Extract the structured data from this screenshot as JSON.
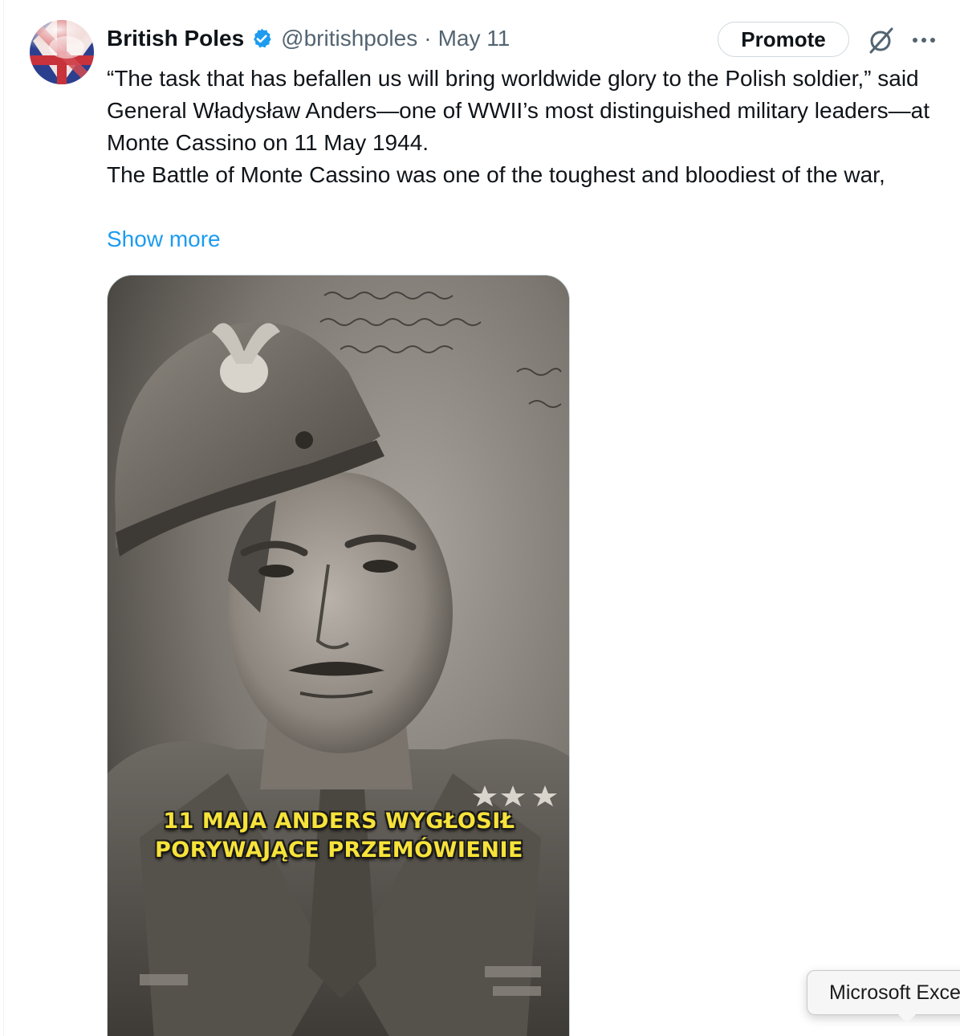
{
  "author": {
    "display_name": "British Poles",
    "verified_icon": "verified-badge-icon",
    "handle": "@britishpoles",
    "separator": "·",
    "date": "May 11"
  },
  "actions": {
    "promote_label": "Promote",
    "grok_icon": "grok-icon",
    "more_icon": "more-icon"
  },
  "tweet": {
    "paragraph_1": "“The task that has befallen us will bring worldwide glory to the Polish soldier,” said General Władysław Anders—one of WWII’s most distinguished military leaders—at Monte Cassino on 11 May 1944.",
    "paragraph_2": "The Battle of Monte Cassino was one of the toughest and bloodiest of the war,",
    "show_more": "Show more"
  },
  "media": {
    "caption_line_1": "11 MAJA ANDERS WYGŁOSIŁ",
    "caption_line_2": "PORYWAJĄCE PRZEMÓWIENIE"
  },
  "tooltip": {
    "text": "Microsoft Excel"
  },
  "colors": {
    "link": "#1d9bf0",
    "secondary_text": "#536471",
    "verified": "#1d9bf0",
    "caption": "#f7e33a"
  }
}
